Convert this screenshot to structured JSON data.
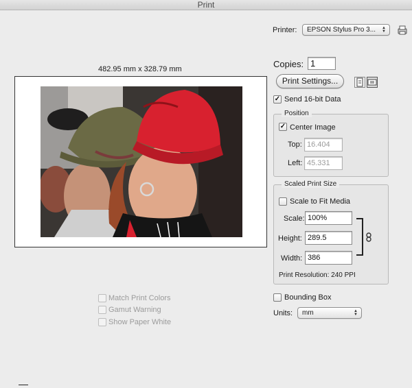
{
  "window": {
    "title": "Print"
  },
  "printer": {
    "label": "Printer:",
    "selected": "EPSON Stylus Pro 3..."
  },
  "preview": {
    "dimensions": "482.95 mm x 328.79 mm"
  },
  "copies": {
    "label": "Copies:",
    "value": "1"
  },
  "buttons": {
    "print_settings": "Print Settings..."
  },
  "send16bit": {
    "label": "Send 16-bit Data",
    "checked": true
  },
  "position": {
    "title": "Position",
    "center_image": {
      "label": "Center Image",
      "checked": true
    },
    "top": {
      "label": "Top:",
      "value": "16.404"
    },
    "left": {
      "label": "Left:",
      "value": "45.331"
    }
  },
  "scaled": {
    "title": "Scaled Print Size",
    "fit_media": {
      "label": "Scale to Fit Media",
      "checked": false
    },
    "scale": {
      "label": "Scale:",
      "value": "100%"
    },
    "height": {
      "label": "Height:",
      "value": "289.5"
    },
    "width": {
      "label": "Width:",
      "value": "386"
    },
    "resolution": "Print Resolution: 240 PPI"
  },
  "bounding_box": {
    "label": "Bounding Box",
    "checked": false
  },
  "units": {
    "label": "Units:",
    "selected": "mm"
  },
  "color_options": [
    {
      "label": "Match Print Colors"
    },
    {
      "label": "Gamut Warning"
    },
    {
      "label": "Show Paper White"
    }
  ],
  "icons": [
    "printer-setup-icon",
    "portrait-orientation-icon",
    "landscape-orientation-icon",
    "chain-link-icon"
  ],
  "colors": {
    "hat_red": "#d8212f",
    "hat_green": "#6b6a45",
    "background": "#ececec"
  }
}
